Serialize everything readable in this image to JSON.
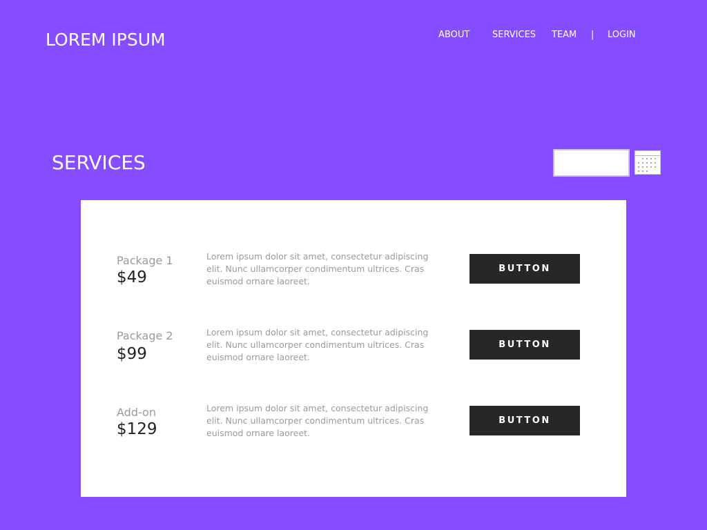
{
  "header": {
    "logo": "LOREM IPSUM",
    "nav": {
      "about": "ABOUT",
      "services": "SERVICES",
      "team": "TEAM",
      "separator": "|",
      "login": "LOGIN"
    }
  },
  "main": {
    "title": "SERVICES",
    "search": {
      "value": "",
      "placeholder": ""
    },
    "calendar_icon": "calendar-icon",
    "packages": [
      {
        "name": "Package 1",
        "price": "$49",
        "description": "Lorem ipsum dolor sit amet, consectetur adipiscing elit. Nunc ullamcorper condimentum ultrices. Cras euismod ornare laoreet.",
        "button_label": "BUTTON"
      },
      {
        "name": "Package 2",
        "price": "$99",
        "description": "Lorem ipsum dolor sit amet, consectetur adipiscing elit. Nunc ullamcorper condimentum ultrices. Cras euismod ornare laoreet.",
        "button_label": "BUTTON"
      },
      {
        "name": "Add-on",
        "price": "$129",
        "description": "Lorem ipsum dolor sit amet, consectetur adipiscing elit. Nunc ullamcorper condimentum ultrices. Cras euismod ornare laoreet.",
        "button_label": "BUTTON"
      }
    ]
  },
  "colors": {
    "background": "#864cff",
    "card": "#ffffff",
    "button": "#272727",
    "muted_text": "#9a9a9a",
    "price_text": "#222222"
  }
}
